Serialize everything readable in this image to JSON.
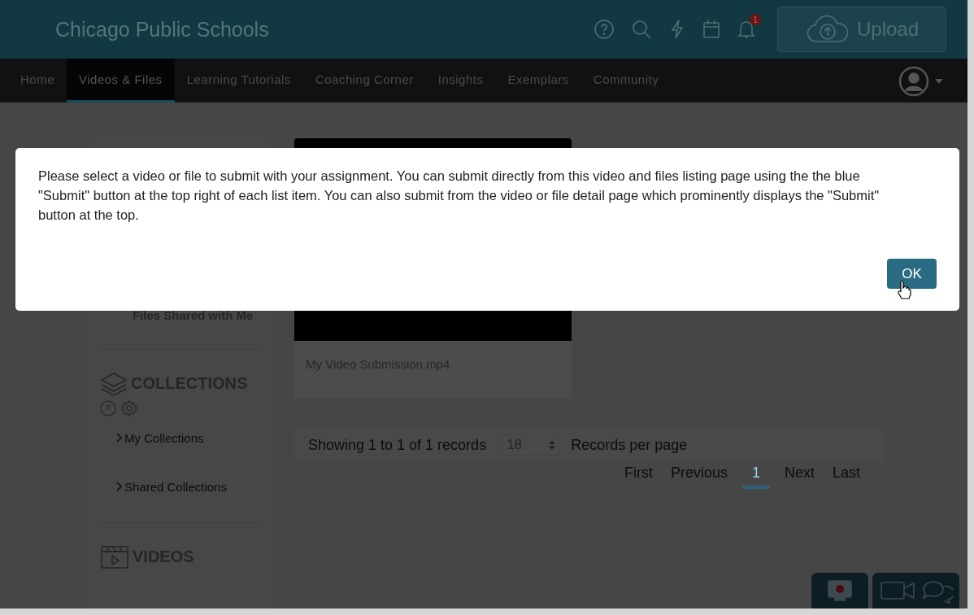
{
  "header": {
    "title": "Chicago Public Schools",
    "notification_count": "1",
    "upload_button": "Upload"
  },
  "nav": {
    "tabs": [
      {
        "label": "Home",
        "selected": false
      },
      {
        "label": "Videos & Files",
        "selected": true
      },
      {
        "label": "Learning Tutorials",
        "selected": false
      },
      {
        "label": "Coaching Corner",
        "selected": false
      },
      {
        "label": "Insights",
        "selected": false
      },
      {
        "label": "Exemplars",
        "selected": false
      },
      {
        "label": "Community",
        "selected": false
      }
    ]
  },
  "sidebar": {
    "shared_item": "Files Shared with Me",
    "collections_heading": "COLLECTIONS",
    "collection_links": [
      "My Collections",
      "Shared Collections"
    ],
    "videos_heading": "VIDEOS"
  },
  "file_card": {
    "name": "My Video Submission.mp4"
  },
  "pagination": {
    "summary": "Showing 1 to 1 of 1 records",
    "per_page": "18",
    "per_page_label": "Records per page",
    "pages": [
      {
        "label": "First",
        "selected": false
      },
      {
        "label": "Previous",
        "selected": false
      },
      {
        "label": "1",
        "selected": true
      },
      {
        "label": "Next",
        "selected": false
      },
      {
        "label": "Last",
        "selected": false
      }
    ]
  },
  "dialog": {
    "message": "Please select a video or file to submit with your assignment. You can submit directly from this video and files listing page using the the blue \"Submit\" button at the top right of each list item. You can also submit from the video or file detail page which prominently displays the \"Submit\" button at the top.",
    "ok_button": "OK"
  }
}
